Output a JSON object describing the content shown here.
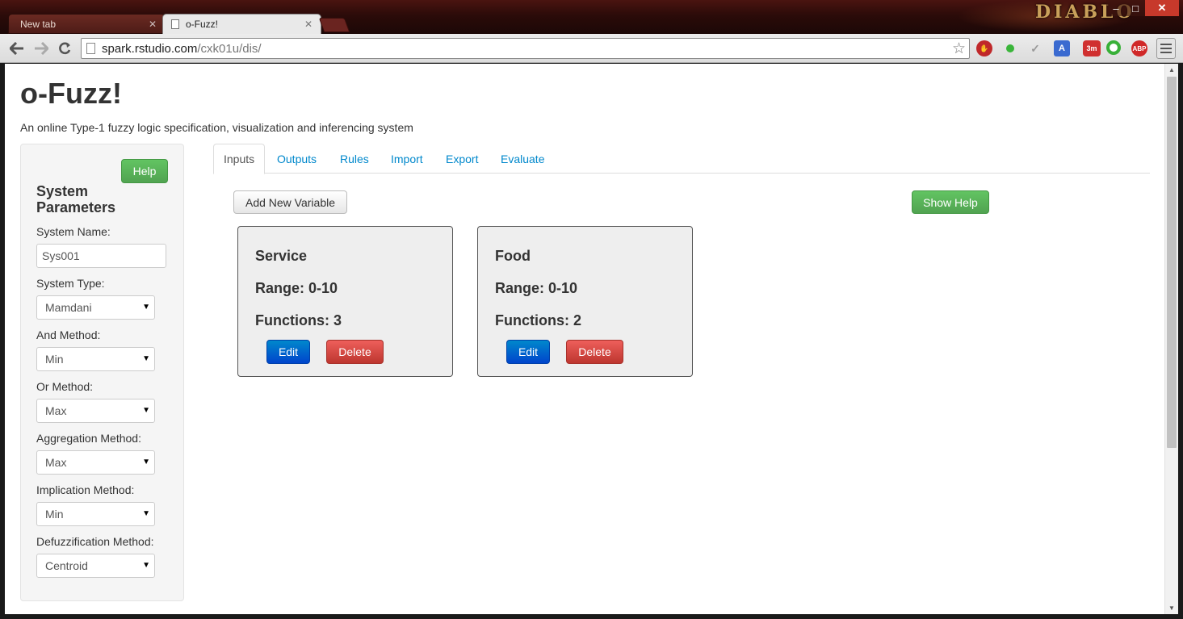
{
  "browser": {
    "tabs": [
      {
        "label": "New tab",
        "active": false
      },
      {
        "label": "o-Fuzz!",
        "active": true
      }
    ],
    "address_host": "spark.rstudio.com",
    "address_path": "/cxk01u/dis/",
    "theme_brand": "DIABLO",
    "extension_badge": "3m",
    "abp_label": "ABP"
  },
  "page": {
    "title": "o-Fuzz!",
    "subtitle": "An online Type-1 fuzzy logic specification, visualization and inferencing system"
  },
  "sidebar": {
    "help_label": "Help",
    "heading": "System Parameters",
    "system_name_label": "System Name:",
    "system_name_value": "Sys001",
    "system_type_label": "System Type:",
    "system_type_value": "Mamdani",
    "and_method_label": "And Method:",
    "and_method_value": "Min",
    "or_method_label": "Or Method:",
    "or_method_value": "Max",
    "aggregation_label": "Aggregation Method:",
    "aggregation_value": "Max",
    "implication_label": "Implication Method:",
    "implication_value": "Min",
    "defuzz_label": "Defuzzification Method:",
    "defuzz_value": "Centroid"
  },
  "tabs": [
    "Inputs",
    "Outputs",
    "Rules",
    "Import",
    "Export",
    "Evaluate"
  ],
  "actions": {
    "add_variable_label": "Add New Variable",
    "show_help_label": "Show Help"
  },
  "variables": [
    {
      "name": "Service",
      "range": "Range: 0-10",
      "functions": "Functions: 3",
      "edit_label": "Edit",
      "delete_label": "Delete"
    },
    {
      "name": "Food",
      "range": "Range: 0-10",
      "functions": "Functions: 2",
      "edit_label": "Edit",
      "delete_label": "Delete"
    }
  ],
  "colors": {
    "success": "#5bb75b",
    "primary": "#0066cc",
    "danger": "#da4f49",
    "link": "#0088cc"
  }
}
